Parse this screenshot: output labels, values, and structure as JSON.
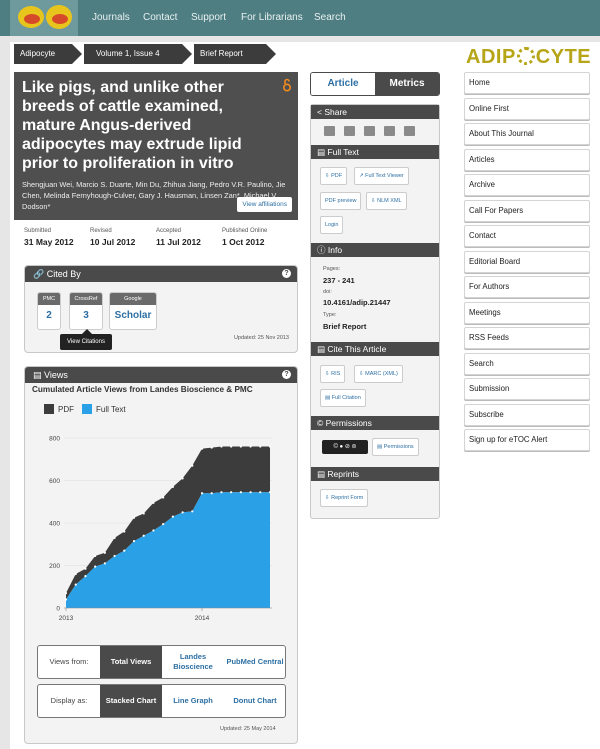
{
  "nav": {
    "links": [
      "Journals",
      "Contact",
      "Support",
      "For Librarians",
      "Search"
    ]
  },
  "breadcrumb": [
    "Adipocyte",
    "Volume 1, Issue 4",
    "Brief Report"
  ],
  "brand": {
    "pre": "ADIP",
    "post": "CYTE"
  },
  "article": {
    "title": "Like pigs, and unlike other breeds of cattle examined, mature Angus-derived adipocytes may extrude lipid prior to proliferation in vitro",
    "authors": "Shengjuan Wei, Marcio S. Duarte, Min Du, Zhihua Jiang, Pedro V.R. Paulino, Jie Chen, Melinda Fernyhough-Culver, Gary J. Hausman, Linsen Zan*, Michael V. Dodson*",
    "affiliations_label": "View affiliations"
  },
  "dates": [
    {
      "label": "Submitted",
      "value": "31 May 2012"
    },
    {
      "label": "Revised",
      "value": "10 Jul 2012"
    },
    {
      "label": "Accepted",
      "value": "11 Jul 2012"
    },
    {
      "label": "Published Online",
      "value": "1 Oct 2012"
    }
  ],
  "cited_by": {
    "title": "Cited By",
    "sources": [
      {
        "tag": "PMC",
        "value": "2"
      },
      {
        "tag": "CrossRef",
        "value": "3"
      },
      {
        "tag": "Google",
        "value": "Scholar"
      }
    ],
    "tooltip": "View Citations",
    "updated": "Updated: 25 Nov 2013"
  },
  "views": {
    "title": "Views",
    "chart_title": "Cumulated Article Views from Landes Bioscience & PMC",
    "legend": [
      "PDF",
      "Full Text"
    ],
    "colors": {
      "pdf": "#3c3c3c",
      "fulltext": "#2aa0e6"
    },
    "toggle_from": {
      "label": "Views from:",
      "options": [
        "Total Views",
        "Landes Bioscience",
        "PubMed Central"
      ],
      "active": 0
    },
    "toggle_display": {
      "label": "Display as:",
      "options": [
        "Stacked Chart",
        "Line Graph",
        "Donut Chart"
      ],
      "active": 0
    },
    "updated": "Updated: 25 May 2014"
  },
  "chart_data": {
    "type": "area",
    "title": "Cumulated Article Views from Landes Bioscience & PMC",
    "xlabel": "",
    "ylabel": "",
    "x_ticks": [
      "2013",
      "2014"
    ],
    "y_ticks": [
      0,
      200,
      400,
      600,
      800
    ],
    "ylim": [
      0,
      800
    ],
    "stacked": true,
    "series": [
      {
        "name": "Full Text",
        "values": [
          40,
          110,
          150,
          195,
          210,
          245,
          270,
          315,
          340,
          365,
          395,
          430,
          450,
          455,
          540,
          540,
          545,
          545,
          545,
          545,
          545,
          545
        ]
      },
      {
        "name": "PDF",
        "values": [
          70,
          160,
          185,
          245,
          260,
          330,
          360,
          425,
          445,
          495,
          520,
          570,
          610,
          670,
          750,
          755,
          760,
          760,
          760,
          760,
          760,
          760
        ]
      }
    ],
    "grid": true
  },
  "tabs": [
    "Article",
    "Metrics"
  ],
  "side": {
    "share": "Share",
    "full_text": "Full Text",
    "full_text_links": [
      "PDF",
      "Full Text Viewer",
      "PDF preview",
      "NLM XML",
      "Login"
    ],
    "info": "Info",
    "pages_label": "Pages:",
    "pages": "237 - 241",
    "doi_label": "doi:",
    "doi": "10.4161/adip.21447",
    "type_label": "Type:",
    "type": "Brief Report",
    "cite": "Cite This Article",
    "cite_links": [
      "RIS",
      "MARC (XML)",
      "Full Citation"
    ],
    "permissions": "Permissions",
    "permissions_link": "Permissions",
    "reprints": "Reprints",
    "reprint_link": "Reprint Form"
  },
  "right_nav": [
    "Home",
    "Online First",
    "About This Journal",
    "Articles",
    "Archive",
    "Call For Papers",
    "Contact",
    "Editorial Board",
    "For Authors",
    "Meetings",
    "RSS Feeds",
    "Search",
    "Submission",
    "Subscribe",
    "Sign up for eTOC Alert"
  ]
}
